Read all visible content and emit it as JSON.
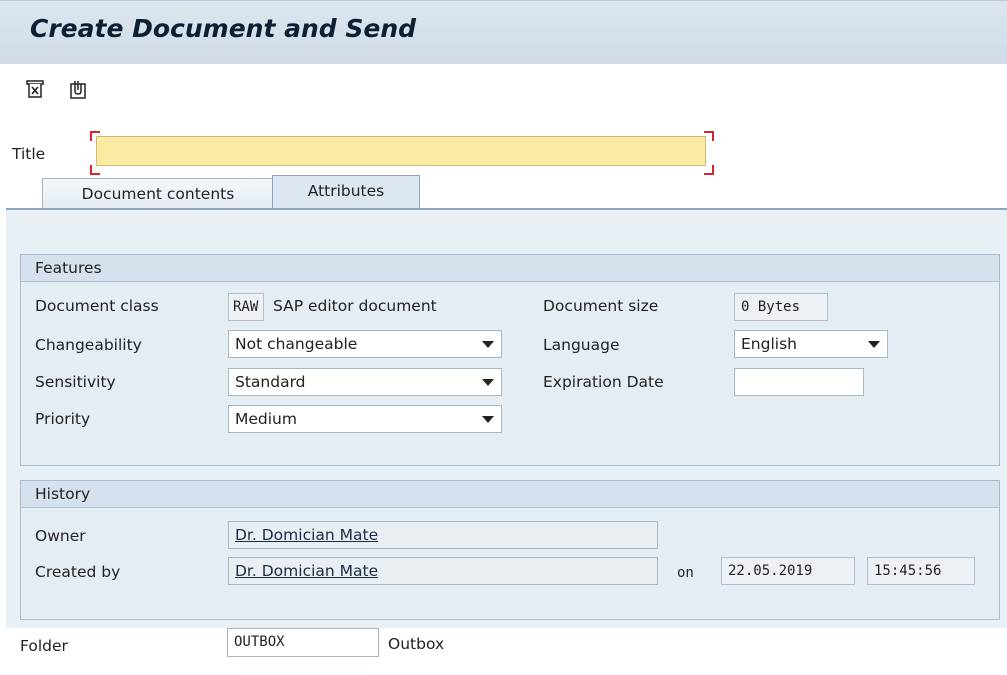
{
  "window": {
    "title": "Create Document and Send"
  },
  "toolbar": {
    "icons": [
      "delete-document-icon",
      "attach-document-icon"
    ]
  },
  "title_field": {
    "label": "Title",
    "value": ""
  },
  "tabs": [
    {
      "label": "Document contents",
      "active": false
    },
    {
      "label": "Attributes",
      "active": true
    }
  ],
  "features": {
    "heading": "Features",
    "document_class": {
      "label": "Document class",
      "code": "RAW",
      "description": "SAP editor document"
    },
    "changeability": {
      "label": "Changeability",
      "value": "Not changeable"
    },
    "sensitivity": {
      "label": "Sensitivity",
      "value": "Standard"
    },
    "priority": {
      "label": "Priority",
      "value": "Medium"
    },
    "document_size": {
      "label": "Document size",
      "value": "0 Bytes"
    },
    "language": {
      "label": "Language",
      "value": "English"
    },
    "expiration_date": {
      "label": "Expiration Date",
      "value": ""
    }
  },
  "history": {
    "heading": "History",
    "owner": {
      "label": "Owner",
      "value": "Dr. Domician Mate"
    },
    "created_by": {
      "label": "Created by",
      "value": "Dr. Domician Mate",
      "on_label": "on",
      "date": "22.05.2019",
      "time": "15:45:56"
    }
  },
  "folder": {
    "label": "Folder",
    "code": "OUTBOX",
    "description": "Outbox"
  },
  "colors": {
    "titlebar": "#d6e0ea",
    "panel": "#e8eff5",
    "required_field": "#fdeaa2",
    "required_marker": "#d9262a"
  }
}
